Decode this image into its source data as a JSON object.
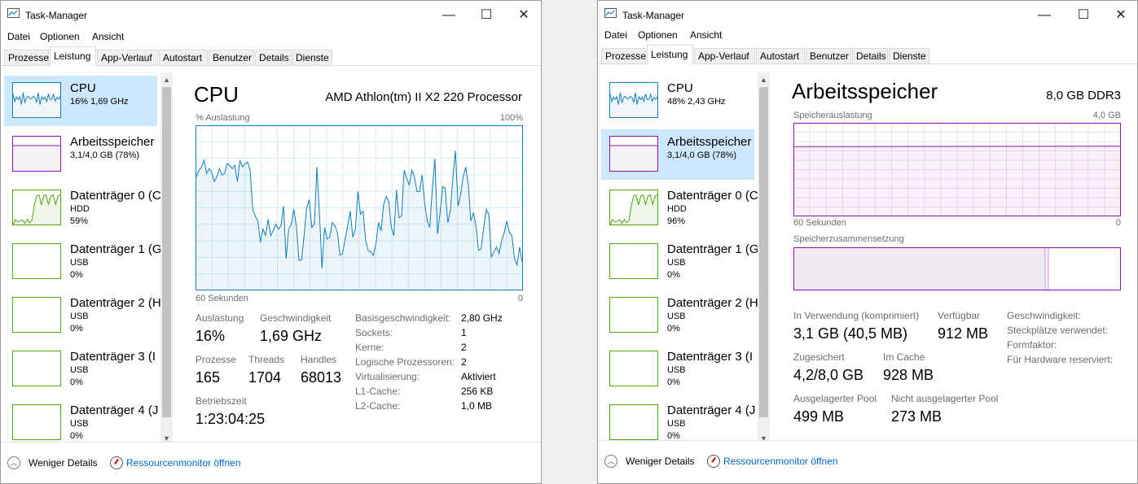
{
  "app_title": "Task-Manager",
  "window_controls": {
    "minimize": "—",
    "maximize": "☐",
    "close": "✕"
  },
  "menu": [
    "Datei",
    "Optionen",
    "Ansicht"
  ],
  "tabs": [
    "Prozesse",
    "Leistung",
    "App-Verlauf",
    "Autostart",
    "Benutzer",
    "Details",
    "Dienste"
  ],
  "active_tab": "Leistung",
  "colors": {
    "cpu": "#117dbb",
    "memory": "#8b12ae",
    "disk": "#4da60c",
    "selection": "#cce8ff",
    "link": "#0066cc"
  },
  "footer": {
    "less_details": "Weniger Details",
    "resource_monitor": "Ressourcenmonitor öffnen"
  },
  "left": {
    "sidebar": [
      {
        "name": "CPU",
        "lines": [
          "16%  1,69 GHz"
        ],
        "kind": "cpu",
        "selected": true
      },
      {
        "name": "Arbeitsspeicher",
        "lines": [
          "3,1/4,0 GB (78%)"
        ],
        "kind": "mem",
        "selected": false
      },
      {
        "name": "Datenträger 0 (C",
        "lines": [
          "HDD",
          "59%"
        ],
        "kind": "disk",
        "selected": false
      },
      {
        "name": "Datenträger 1 (G",
        "lines": [
          "USB",
          "0%"
        ],
        "kind": "disk",
        "selected": false
      },
      {
        "name": "Datenträger 2 (H",
        "lines": [
          "USB",
          "0%"
        ],
        "kind": "disk",
        "selected": false
      },
      {
        "name": "Datenträger 3 (I",
        "lines": [
          "USB",
          "0%"
        ],
        "kind": "disk",
        "selected": false
      },
      {
        "name": "Datenträger 4 (J",
        "lines": [
          "USB",
          "0%"
        ],
        "kind": "disk",
        "selected": false
      }
    ],
    "title": "CPU",
    "processor": "AMD Athlon(tm) II X2 220 Processor",
    "graph_top_left": "% Auslastung",
    "graph_top_right": "100%",
    "graph_bottom_left": "60 Sekunden",
    "graph_bottom_right": "0",
    "cpu_history_percent": [
      69,
      73,
      75,
      79,
      71,
      74,
      72,
      66,
      69,
      74,
      70,
      71,
      77,
      76,
      74,
      76,
      66,
      79,
      75,
      77,
      78,
      73,
      49,
      45,
      42,
      29,
      37,
      33,
      43,
      33,
      36,
      40,
      37,
      39,
      51,
      19,
      37,
      40,
      49,
      39,
      18,
      18,
      33,
      50,
      55,
      38,
      40,
      75,
      46,
      13,
      38,
      31,
      32,
      41,
      39,
      35,
      21,
      22,
      31,
      39,
      48,
      32,
      37,
      60,
      46,
      48,
      30,
      24,
      23,
      21,
      28,
      41,
      36,
      52,
      57,
      54,
      38,
      33,
      61,
      44,
      45,
      73,
      68,
      64,
      73,
      69,
      60,
      60,
      70,
      53,
      42,
      38,
      62,
      80,
      34,
      47,
      63,
      62,
      41,
      48,
      69,
      85,
      51,
      58,
      69,
      75,
      64,
      42,
      47,
      39,
      24,
      25,
      38,
      49,
      46,
      20,
      23,
      26,
      22,
      30,
      35,
      42,
      35,
      33,
      19,
      15,
      26,
      17
    ],
    "stats": {
      "auslastung": {
        "label": "Auslastung",
        "value": "16%"
      },
      "geschwindigkeit": {
        "label": "Geschwindigkeit",
        "value": "1,69 GHz"
      },
      "prozesse": {
        "label": "Prozesse",
        "value": "165"
      },
      "threads": {
        "label": "Threads",
        "value": "1704"
      },
      "handles": {
        "label": "Handles",
        "value": "68013"
      },
      "betriebszeit": {
        "label": "Betriebszeit",
        "value": "1:23:04:25"
      }
    },
    "details": [
      {
        "label": "Basisgeschwindigkeit:",
        "value": "2,80 GHz"
      },
      {
        "label": "Sockets:",
        "value": "1"
      },
      {
        "label": "Kerne:",
        "value": "2"
      },
      {
        "label": "Logische Prozessoren:",
        "value": "2"
      },
      {
        "label": "Virtualisierung:",
        "value": "Aktiviert"
      },
      {
        "label": "L1-Cache:",
        "value": "256 KB"
      },
      {
        "label": "L2-Cache:",
        "value": "1,0 MB"
      }
    ]
  },
  "right": {
    "sidebar": [
      {
        "name": "CPU",
        "lines": [
          "48%  2,43 GHz"
        ],
        "kind": "cpu",
        "selected": false
      },
      {
        "name": "Arbeitsspeicher",
        "lines": [
          "3,1/4,0 GB (78%)"
        ],
        "kind": "mem",
        "selected": true
      },
      {
        "name": "Datenträger 0 (C",
        "lines": [
          "HDD",
          "96%"
        ],
        "kind": "disk",
        "selected": false
      },
      {
        "name": "Datenträger 1 (G",
        "lines": [
          "USB",
          "0%"
        ],
        "kind": "disk",
        "selected": false
      },
      {
        "name": "Datenträger 2 (H",
        "lines": [
          "USB",
          "0%"
        ],
        "kind": "disk",
        "selected": false
      },
      {
        "name": "Datenträger 3 (I",
        "lines": [
          "USB",
          "0%"
        ],
        "kind": "disk",
        "selected": false
      },
      {
        "name": "Datenträger 4 (J",
        "lines": [
          "USB",
          "0%"
        ],
        "kind": "disk",
        "selected": false
      }
    ],
    "title": "Arbeitsspeicher",
    "capacity": "8,0 GB DDR3",
    "usage_label": "Speicherauslastung",
    "usage_max": "4,0 GB",
    "graph_bottom_left": "60 Sekunden",
    "graph_bottom_right": "0",
    "memory_usage_fraction": 0.75,
    "composition_label": "Speicherzusammensetzung",
    "composition_in_use_fraction": 0.77,
    "stats": {
      "in_verwendung": {
        "label": "In Verwendung (komprimiert)",
        "value": "3,1 GB (40,5 MB)"
      },
      "verfuegbar": {
        "label": "Verfügbar",
        "value": "912 MB"
      },
      "zugesichert": {
        "label": "Zugesichert",
        "value": "4,2/8,0 GB"
      },
      "im_cache": {
        "label": "Im Cache",
        "value": "928 MB"
      },
      "ausgelagert": {
        "label": "Ausgelagerter Pool",
        "value": "499 MB"
      },
      "nicht_ausgelagert": {
        "label": "Nicht ausgelagerter Pool",
        "value": "273 MB"
      }
    },
    "details": [
      {
        "label": "Geschwindigkeit:"
      },
      {
        "label": "Steckplätze verwendet:"
      },
      {
        "label": "Formfaktor:"
      },
      {
        "label": "Für Hardware reserviert:"
      }
    ]
  }
}
